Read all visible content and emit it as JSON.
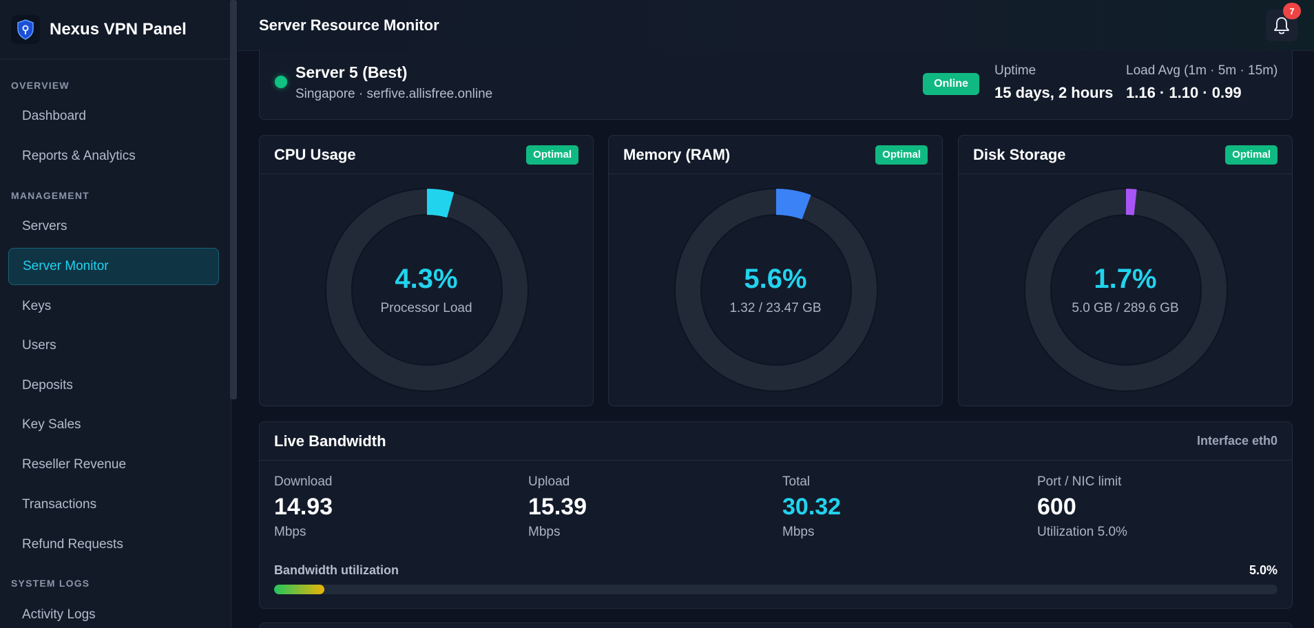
{
  "brand": {
    "title": "Nexus VPN Panel"
  },
  "sidebar": {
    "sections": [
      {
        "label": "OVERVIEW"
      },
      {
        "label": "MANAGEMENT"
      },
      {
        "label": "SYSTEM LOGS"
      }
    ],
    "items": [
      {
        "label": "Dashboard"
      },
      {
        "label": "Reports & Analytics"
      },
      {
        "label": "Servers"
      },
      {
        "label": "Server Monitor",
        "active": true
      },
      {
        "label": "Keys"
      },
      {
        "label": "Users"
      },
      {
        "label": "Deposits"
      },
      {
        "label": "Key Sales"
      },
      {
        "label": "Reseller Revenue"
      },
      {
        "label": "Transactions"
      },
      {
        "label": "Refund Requests"
      },
      {
        "label": "Activity Logs"
      }
    ]
  },
  "header": {
    "title": "Server Resource Monitor",
    "notifications": "7",
    "bell_icon": "bell-icon"
  },
  "server": {
    "name": "Server 5 (Best)",
    "location": "Singapore · serfive.allisfree.online",
    "status": "Online",
    "uptime_label": "Uptime",
    "uptime_value": "15 days, 2 hours",
    "load_label": "Load Avg (1m · 5m · 15m)",
    "load_value": "1.16 · 1.10 · 0.99"
  },
  "gauges": [
    {
      "title": "CPU Usage",
      "status": "Optimal",
      "value": "4.3%",
      "fraction": 0.043,
      "sub": "Processor Load",
      "color": "#22d3ee"
    },
    {
      "title": "Memory (RAM)",
      "status": "Optimal",
      "value": "5.6%",
      "fraction": 0.056,
      "sub": "1.32 / 23.47 GB",
      "color": "#3b82f6"
    },
    {
      "title": "Disk Storage",
      "status": "Optimal",
      "value": "1.7%",
      "fraction": 0.017,
      "sub": "5.0 GB / 289.6 GB",
      "color": "#a855f7"
    }
  ],
  "bandwidth": {
    "title": "Live Bandwidth",
    "interface": "Interface eth0",
    "metrics": [
      {
        "label": "Download",
        "value": "14.93",
        "unit": "Mbps"
      },
      {
        "label": "Upload",
        "value": "15.39",
        "unit": "Mbps"
      },
      {
        "label": "Total",
        "value": "30.32",
        "unit": "Mbps"
      },
      {
        "label": "Port / NIC limit",
        "value": "600",
        "unit": "Utilization 5.0%"
      }
    ],
    "utilization_label": "Bandwidth utilization",
    "utilization_value": "5.0%",
    "utilization_fraction": 0.05
  },
  "colors": {
    "accent": "#22d3ee",
    "success": "#10b981",
    "danger": "#ef4444"
  }
}
